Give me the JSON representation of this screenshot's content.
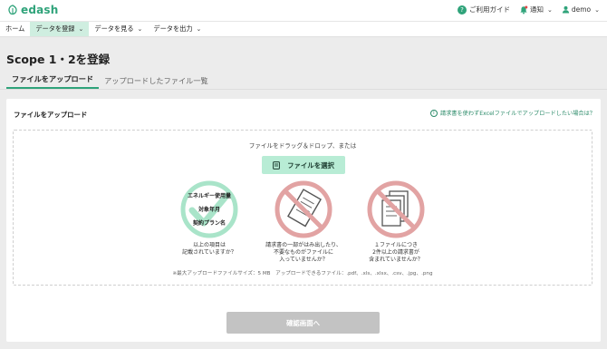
{
  "header": {
    "logo_text": "edash",
    "guide_badge": "?",
    "guide_label": "ご利用ガイド",
    "notify_label": "通知",
    "user_label": "demo",
    "brand_color": "#2fa37a"
  },
  "nav": {
    "home": "ホーム",
    "items": [
      {
        "label": "データを登録"
      },
      {
        "label": "データを見る"
      },
      {
        "label": "データを出力"
      }
    ]
  },
  "page": {
    "title": "Scope 1・2を登録"
  },
  "tabs": [
    {
      "label": "ファイルをアップロード"
    },
    {
      "label": "アップロードしたファイル一覧"
    }
  ],
  "card": {
    "title": "ファイルをアップロード",
    "help_icon": "i",
    "help_link": "請求書を使わずExcelファイルでアップロードしたい場合は？",
    "drop_text": "ファイルをドラッグ＆ドロップ、または",
    "select_button": "ファイルを選択",
    "tips": [
      {
        "check_items": [
          "エネルギー使用量",
          "対象年月",
          "契約プラン名"
        ],
        "caption": [
          "以上の項目は",
          "記載されていますか？"
        ]
      },
      {
        "caption": [
          "請求書の一部がはみ出したり、",
          "不要なものがファイルに",
          "入っていませんか？"
        ]
      },
      {
        "caption": [
          "１ファイルにつき",
          "2件以上の請求書が",
          "含まれていませんか？"
        ]
      }
    ],
    "note": "※最大アップロードファイルサイズ：5 MB　アップロードできるファイル：.pdf、.xls、.xlsx、.csv、.jpg、.png",
    "confirm_button": "確認画面へ"
  }
}
